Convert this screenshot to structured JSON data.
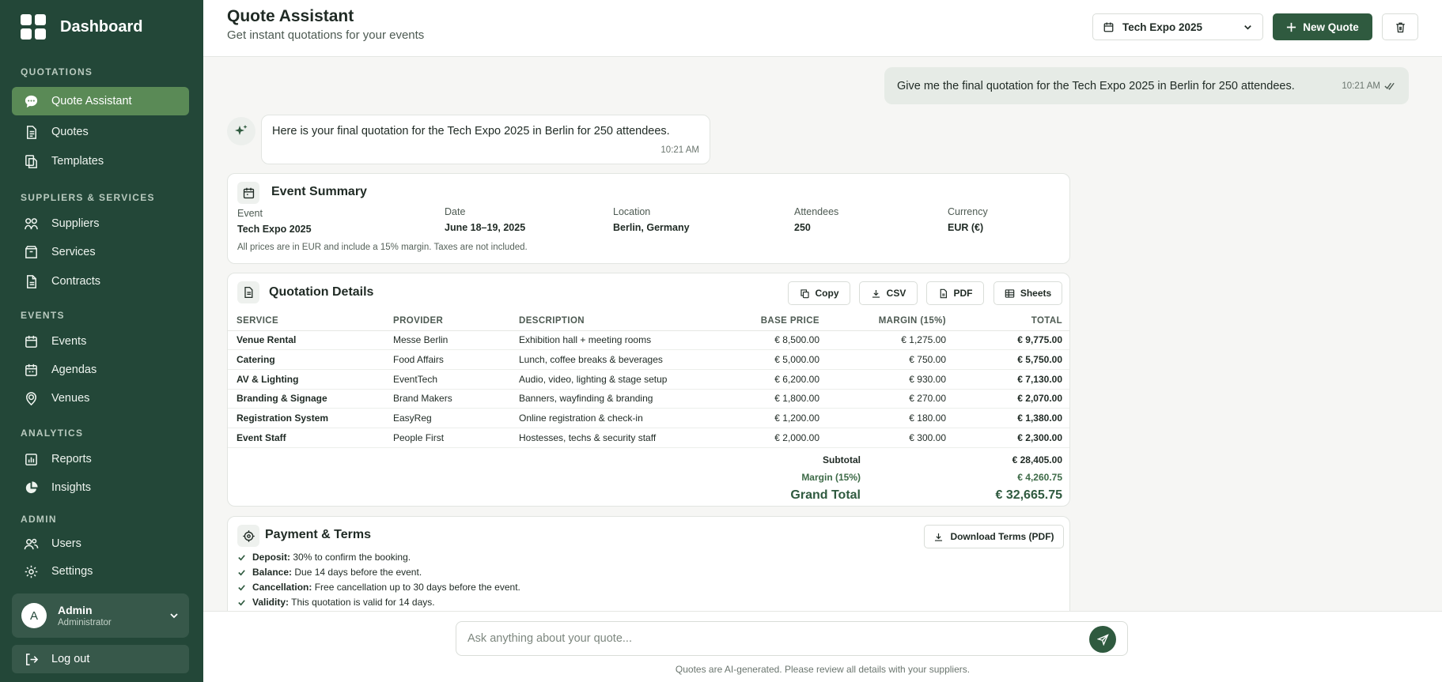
{
  "sidebar": {
    "brand": "Dashboard",
    "sections": [
      {
        "title": "QUOTATIONS",
        "items": [
          {
            "label": "Quote Assistant",
            "icon": "chat-icon",
            "active": true
          },
          {
            "label": "Quotes",
            "icon": "document-icon"
          },
          {
            "label": "Templates",
            "icon": "copy-icon"
          }
        ]
      },
      {
        "title": "SUPPLIERS & SERVICES",
        "items": [
          {
            "label": "Suppliers",
            "icon": "grid-icon"
          },
          {
            "label": "Services",
            "icon": "box-icon"
          },
          {
            "label": "Contracts",
            "icon": "contract-icon"
          }
        ]
      },
      {
        "title": "EVENTS",
        "items": [
          {
            "label": "Events",
            "icon": "calendar-icon"
          },
          {
            "label": "Agendas",
            "icon": "agenda-icon"
          },
          {
            "label": "Venues",
            "icon": "location-icon"
          }
        ]
      },
      {
        "title": "ANALYTICS",
        "items": [
          {
            "label": "Reports",
            "icon": "bar-chart-icon"
          },
          {
            "label": "Insights",
            "icon": "pie-chart-icon"
          }
        ]
      },
      {
        "title": "ADMIN",
        "items": [
          {
            "label": "Users",
            "icon": "users-icon"
          },
          {
            "label": "Settings",
            "icon": "gear-icon"
          }
        ]
      }
    ],
    "user": {
      "initial": "A",
      "name": "Admin",
      "role": "Administrator"
    },
    "logout_label": "Log out"
  },
  "header": {
    "title": "Quote Assistant",
    "subtitle": "Get instant quotations for your events",
    "event_select": "Tech Expo 2025",
    "new_quote_label": "New Quote"
  },
  "chat": {
    "user_message": "Give me the final quotation for the Tech Expo 2025 in Berlin for 250 attendees.",
    "user_time": "10:21 AM",
    "bot_message": "Here is your final quotation for the Tech Expo 2025 in Berlin for 250 attendees.",
    "bot_time": "10:21 AM"
  },
  "event_summary": {
    "title": "Event Summary",
    "fields": [
      {
        "label": "Event",
        "value": "Tech Expo 2025"
      },
      {
        "label": "Date",
        "value": "June 18–19, 2025"
      },
      {
        "label": "Location",
        "value": "Berlin, Germany"
      },
      {
        "label": "Attendees",
        "value": "250"
      },
      {
        "label": "Currency",
        "value": "EUR (€)"
      }
    ],
    "note": "All prices are in EUR and include a 15% margin. Taxes are not included."
  },
  "quotation": {
    "title": "Quotation Details",
    "actions": {
      "copy": "Copy",
      "csv": "CSV",
      "pdf": "PDF",
      "sheets": "Sheets"
    },
    "columns": [
      "SERVICE",
      "PROVIDER",
      "DESCRIPTION",
      "BASE PRICE",
      "MARGIN (15%)",
      "TOTAL"
    ],
    "rows": [
      [
        "Venue Rental",
        "Messe Berlin",
        "Exhibition hall + meeting rooms",
        "€ 8,500.00",
        "€ 1,275.00",
        "€ 9,775.00"
      ],
      [
        "Catering",
        "Food Affairs",
        "Lunch, coffee breaks & beverages",
        "€ 5,000.00",
        "€ 750.00",
        "€ 5,750.00"
      ],
      [
        "AV & Lighting",
        "EventTech",
        "Audio, video, lighting & stage setup",
        "€ 6,200.00",
        "€ 930.00",
        "€ 7,130.00"
      ],
      [
        "Branding & Signage",
        "Brand Makers",
        "Banners, wayfinding & branding",
        "€ 1,800.00",
        "€ 270.00",
        "€ 2,070.00"
      ],
      [
        "Registration System",
        "EasyReg",
        "Online registration & check-in",
        "€ 1,200.00",
        "€ 180.00",
        "€ 1,380.00"
      ],
      [
        "Event Staff",
        "People First",
        "Hostesses, techs & security staff",
        "€ 2,000.00",
        "€ 300.00",
        "€ 2,300.00"
      ]
    ],
    "subtotal_label": "Subtotal",
    "subtotal": "€ 28,405.00",
    "margin_label": "Margin (15%)",
    "margin": "€ 4,260.75",
    "grand_total_label": "Grand Total",
    "grand_total": "€ 32,665.75"
  },
  "payment": {
    "title": "Payment & Terms",
    "download_label": "Download Terms (PDF)",
    "terms": [
      {
        "label": "Deposit:",
        "text": "30% to confirm the booking."
      },
      {
        "label": "Balance:",
        "text": "Due 14 days before the event."
      },
      {
        "label": "Cancellation:",
        "text": "Free cancellation up to 30 days before the event."
      },
      {
        "label": "Validity:",
        "text": "This quotation is valid for 14 days."
      }
    ]
  },
  "composer": {
    "placeholder": "Ask anything about your quote...",
    "disclaimer": "Quotes are AI-generated. Please review all details with your suppliers."
  },
  "colors": {
    "sidebar": "#234738",
    "accent": "#2f5a3f",
    "active": "#5a8a56"
  }
}
